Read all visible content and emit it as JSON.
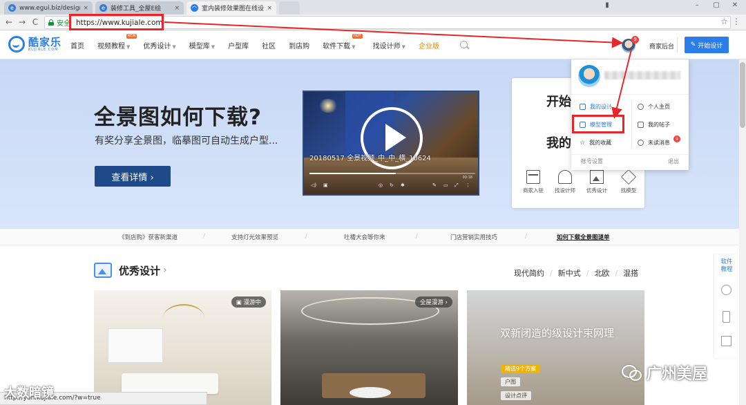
{
  "browser": {
    "tabs": [
      {
        "title": "www.egui.biz/design/l",
        "icon": "ie-icon",
        "active": false
      },
      {
        "title": "装修工具_全屋E绘",
        "icon": "ie-icon",
        "active": false
      },
      {
        "title": "室内装修效果图在线设计",
        "icon": "kujiale-icon",
        "active": true
      }
    ],
    "close_glyph": "×",
    "secure_label": "安全",
    "url": "https://www.kujiale.com"
  },
  "header": {
    "logo_cn": "酷家乐",
    "logo_en": "KUJIALE.COM",
    "nav": [
      {
        "label": "首页",
        "caret": false,
        "badge": ""
      },
      {
        "label": "视频教程",
        "caret": true,
        "badge": "NEW"
      },
      {
        "label": "优秀设计",
        "caret": true,
        "badge": ""
      },
      {
        "label": "模型库",
        "caret": true,
        "badge": ""
      },
      {
        "label": "户型库",
        "caret": false,
        "badge": ""
      },
      {
        "label": "社区",
        "caret": false,
        "badge": ""
      },
      {
        "label": "到店购",
        "caret": false,
        "badge": ""
      },
      {
        "label": "软件下载",
        "caret": true,
        "badge": "HOT"
      },
      {
        "label": "找设计师",
        "caret": true,
        "badge": ""
      },
      {
        "label": "企业版",
        "caret": false,
        "badge": "",
        "accent": true
      }
    ],
    "avatar_badge": "9",
    "biz_link": "商家后台",
    "start_design": "开始设计"
  },
  "hero": {
    "title": "全景图如何下载?",
    "subtitle": "有奖分享全景图，临摹图可自动生成户型...",
    "button": "查看详情 ›",
    "video_caption": "20180517 全景视频_中_中_横_10624",
    "video_time": "00:18",
    "video_progress": 0.52,
    "side_title_1": "开始",
    "side_title_2": "我的",
    "quick_links": [
      {
        "label": "商家入驻",
        "icon": "store-icon"
      },
      {
        "label": "找设计师",
        "icon": "designer-icon"
      },
      {
        "label": "优秀设计",
        "icon": "image-icon"
      },
      {
        "label": "找模型",
        "icon": "box-icon"
      }
    ]
  },
  "dropdown": {
    "items": [
      {
        "label": "我的设计",
        "col": 0,
        "row": 0,
        "style": "blue"
      },
      {
        "label": "个人主页",
        "col": 1,
        "row": 0,
        "style": ""
      },
      {
        "label": "模型管理",
        "col": 0,
        "row": 1,
        "style": "highlight"
      },
      {
        "label": "我的帖子",
        "col": 1,
        "row": 1,
        "style": ""
      },
      {
        "label": "我的收藏",
        "col": 0,
        "row": 2,
        "style": ""
      },
      {
        "label": "未读消息",
        "col": 1,
        "row": 2,
        "style": "",
        "badge": "9"
      }
    ],
    "account_settings": "帐号设置",
    "logout": "退出"
  },
  "ticker": [
    "《到店购》获客新渠道",
    "支持灯光效果预览",
    "吐槽大会等你来",
    "门店营销实用技巧",
    "如何下载全景图谜单"
  ],
  "section": {
    "title": "优秀设计",
    "arrow": "›",
    "filters": [
      "现代简约",
      "新中式",
      "北欧",
      "混搭"
    ]
  },
  "cards": [
    {
      "badge": "漫游中"
    },
    {
      "badge": "全屋漫游 ›"
    },
    {
      "title": "双新闭造的级设计束网理",
      "tags": [
        "精选9个方案",
        "户图",
        "设计点评"
      ]
    }
  ],
  "side_tools": {
    "label": "软件教程"
  },
  "status_url": "http://yun.kujiale.com/?w=true",
  "watermarks": {
    "left": "大数暗镜",
    "right": "广州美屋"
  },
  "colors": {
    "brand": "#2b7de9",
    "annotation": "#e8252b",
    "accent": "#e88b00"
  }
}
